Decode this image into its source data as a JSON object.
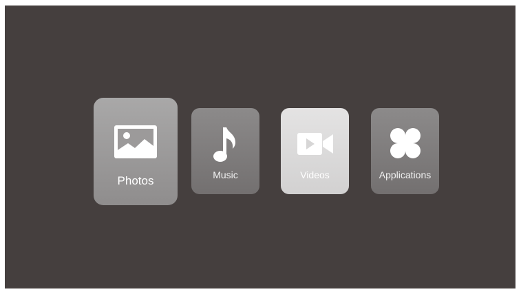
{
  "menu": {
    "items": [
      {
        "label": "Photos",
        "icon": "photo-icon",
        "focused": true
      },
      {
        "label": "Music",
        "icon": "music-note-icon",
        "focused": false
      },
      {
        "label": "Videos",
        "icon": "video-camera-icon",
        "focused": false
      },
      {
        "label": "Applications",
        "icon": "apps-icon",
        "focused": false
      }
    ]
  },
  "colors": {
    "background": "#453f3e",
    "tile_focused": "#a9a8a8",
    "tile_default": "#807d7d",
    "tile_videos": "#dddcdc",
    "text": "#ffffff"
  }
}
